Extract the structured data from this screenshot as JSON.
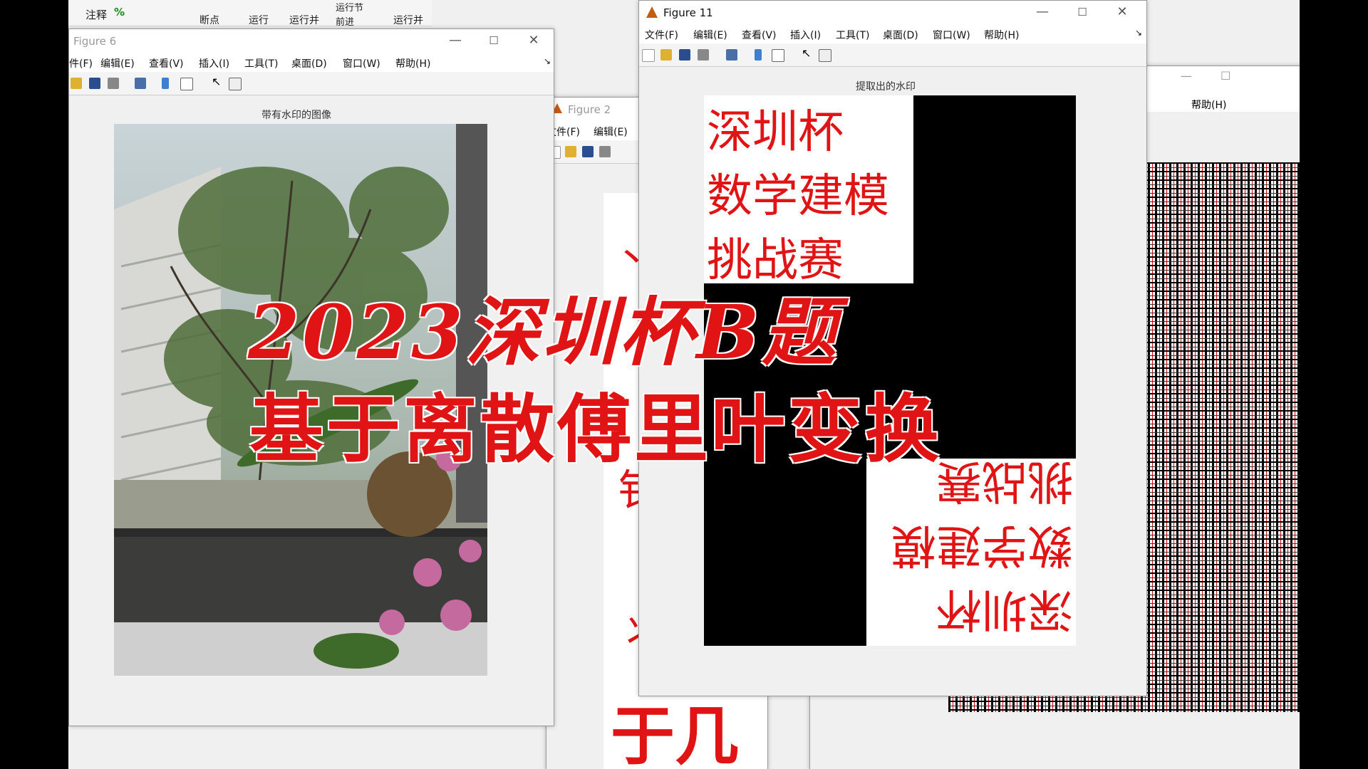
{
  "ribbon": {
    "items": [
      "注释",
      "%",
      "断点",
      "运行",
      "运行并",
      "运行节",
      "前进",
      "运行并"
    ]
  },
  "fig6": {
    "title": "Figure 6",
    "menu": [
      "件(F)",
      "编辑(E)",
      "查看(V)",
      "插入(I)",
      "工具(T)",
      "桌面(D)",
      "窗口(W)",
      "帮助(H)"
    ],
    "axes_title": "带有水印的图像"
  },
  "fig2": {
    "title": "Figure 2",
    "menu": [
      "文件(F)",
      "编辑(E)"
    ]
  },
  "bgwin": {
    "menu_help": "帮助(H)"
  },
  "fig11": {
    "title": "Figure 11",
    "menu": [
      "文件(F)",
      "编辑(E)",
      "查看(V)",
      "插入(I)",
      "工具(T)",
      "桌面(D)",
      "窗口(W)",
      "帮助(H)"
    ],
    "axes_title": "提取出的水印",
    "watermark_lines": [
      "深圳杯",
      "数学建模",
      "挑战赛"
    ]
  },
  "overlay": {
    "line1": "2023深圳杯B题",
    "line2": "基于离散傅里叶变换"
  },
  "colors": {
    "accent": "#e01414"
  }
}
